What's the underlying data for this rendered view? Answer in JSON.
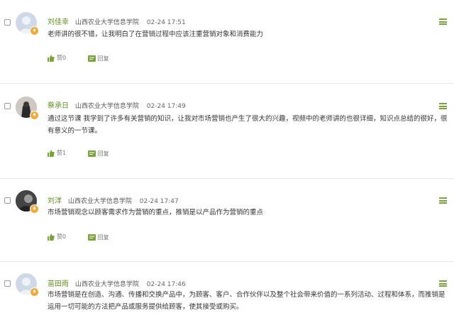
{
  "comments": [
    {
      "name": "刘佳幸",
      "school": "山西农业大学信息学院",
      "time": "02-24 17:51",
      "text": "老师讲的很不错，让我明白了在营销过程中应该注重营销对象和消费能力",
      "like_label": "赞0",
      "reply_label": "回复",
      "avatar_icon": "default-user-avatar"
    },
    {
      "name": "蔡承日",
      "school": "山西农业大学信息学院",
      "time": "02-24 17:49",
      "text": "通过这节课 我学到了许多有关营销的知识，让我对市场营销也产生了很大的兴趣，视频中的老师讲的也很详细，知识点总结的很好，很有意义的一节课。",
      "like_label": "赞1",
      "reply_label": "回复",
      "avatar_icon": "photo-avatar"
    },
    {
      "name": "刘洋",
      "school": "山西农业大学信息学院",
      "time": "02-24 17:47",
      "text": "市场营销观念以顾客需求作为营销的重点，推销是以产品作为营销的重点",
      "like_label": "赞0",
      "reply_label": "回复",
      "avatar_icon": "photo-avatar"
    },
    {
      "name": "苗田雨",
      "school": "山西农业大学信息学院",
      "time": "02-24 17:46",
      "text": "市场营销是在创造、沟通、传播和交换产品中，为顾客、客户、合作伙伴以及整个社会带来价值的一系列活动、过程和体系，而推销是运用一切可能的方法把产品或服务提供给顾客，使其接受或购买。",
      "like_label": "",
      "reply_label": "",
      "avatar_icon": "default-user-avatar"
    }
  ],
  "colors": {
    "accent": "#5f8f1e",
    "icon_green": "#7aa33a",
    "badge": "#f2a93b"
  }
}
